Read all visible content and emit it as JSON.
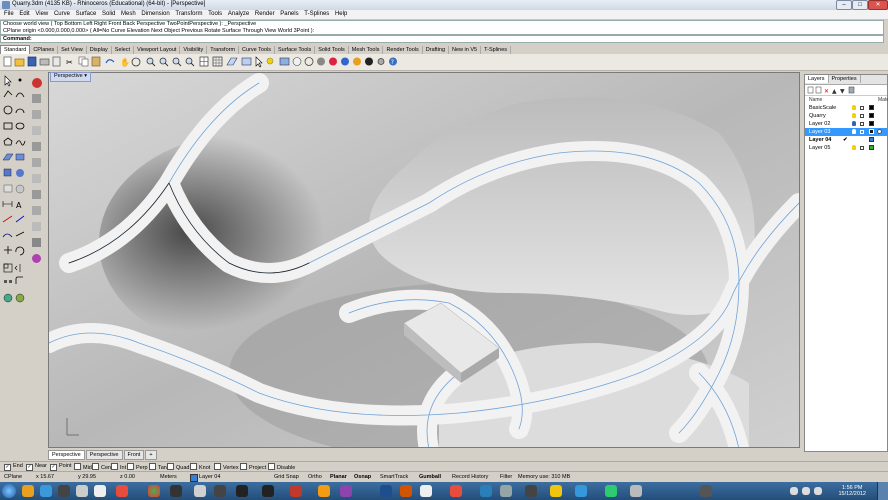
{
  "window": {
    "title": "Quarry.3dm (4135 KB) - Rhinoceros (Educational) (64-bit) - [Perspective]",
    "controls": [
      "–",
      "□",
      "✕"
    ]
  },
  "menu": [
    "File",
    "Edit",
    "View",
    "Curve",
    "Surface",
    "Solid",
    "Mesh",
    "Dimension",
    "Transform",
    "Tools",
    "Analyze",
    "Render",
    "Panels",
    "T-Splines",
    "Help"
  ],
  "command": {
    "history": [
      "Choose world view ( Top  Bottom  Left  Right  Front  Back  Perspective  TwoPointPerspective ): _Perspective",
      "CPlane origin <0.000,0.000,0.000> ( All=No  Curve  Elevation  Next  Object  Previous  Rotate  Surface  Through  View  World  3Point ):"
    ],
    "prompt": "Command:"
  },
  "toolbar_tabs": [
    "Standard",
    "CPlanes",
    "Set View",
    "Display",
    "Select",
    "Viewport Layout",
    "Visibility",
    "Transform",
    "Curve Tools",
    "Surface Tools",
    "Solid Tools",
    "Mesh Tools",
    "Render Tools",
    "Drafting",
    "New in V5",
    "T-Splines"
  ],
  "toolbar_tabs_active": 0,
  "viewport": {
    "label": "Perspective",
    "tabs": [
      "Perspective",
      "Perspective",
      "Front",
      "+"
    ],
    "active_tab": 0
  },
  "layers_panel": {
    "tabs": [
      "Layers",
      "Properties"
    ],
    "header": {
      "name": "Name",
      "material": "Mate"
    },
    "rows": [
      {
        "name": "BasicScale",
        "selected": false,
        "current": false,
        "color": "#000000"
      },
      {
        "name": "Quarry",
        "selected": false,
        "current": false,
        "color": "#000000"
      },
      {
        "name": "Layer 02",
        "selected": false,
        "current": false,
        "color": "#000000"
      },
      {
        "name": "Layer 03",
        "selected": true,
        "current": false,
        "color": "#1a1a1a"
      },
      {
        "name": "Layer 04",
        "selected": false,
        "current": true,
        "color": "#3a7dd6"
      },
      {
        "name": "Layer 05",
        "selected": false,
        "current": false,
        "color": "#38a838"
      }
    ],
    "current_mark": "✔"
  },
  "osnaps": [
    {
      "label": "End",
      "checked": true
    },
    {
      "label": "Near",
      "checked": true
    },
    {
      "label": "Point",
      "checked": true
    },
    {
      "label": "Mid",
      "checked": false
    },
    {
      "label": "Cen",
      "checked": false
    },
    {
      "label": "Int",
      "checked": false
    },
    {
      "label": "Perp",
      "checked": false
    },
    {
      "label": "Tan",
      "checked": false
    },
    {
      "label": "Quad",
      "checked": false
    },
    {
      "label": "Knot",
      "checked": false
    },
    {
      "label": "Vertex",
      "checked": false
    },
    {
      "label": "Project",
      "checked": false
    },
    {
      "label": "Disable",
      "checked": false
    }
  ],
  "status": {
    "cplane": "CPlane",
    "x": "x 15.67",
    "y": "y 29.95",
    "z": "z 0.00",
    "units": "Meters",
    "layer": "Layer 04",
    "toggles": [
      {
        "label": "Grid Snap",
        "bold": false
      },
      {
        "label": "Ortho",
        "bold": false
      },
      {
        "label": "Planar",
        "bold": true
      },
      {
        "label": "Osnap",
        "bold": true
      },
      {
        "label": "SmartTrack",
        "bold": false
      },
      {
        "label": "Gumball",
        "bold": true
      },
      {
        "label": "Record History",
        "bold": false
      },
      {
        "label": "Filter",
        "bold": false
      }
    ],
    "memory": "Memory use: 310 MB"
  },
  "taskbar": {
    "time": "1:56 PM",
    "date": "15/12/2012"
  },
  "colors": {
    "selection": "#3399ff",
    "taskbar": "#2a5a8a",
    "surface_line": "#6fa3d8"
  }
}
